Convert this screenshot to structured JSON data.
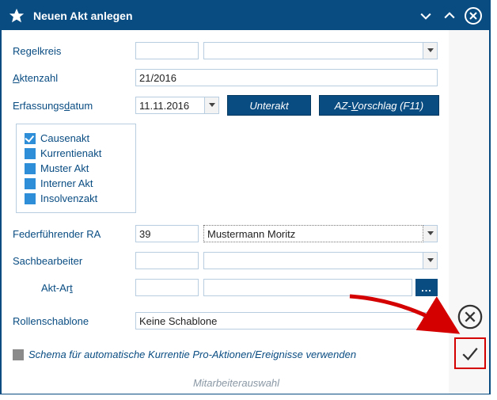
{
  "title": "Neuen Akt anlegen",
  "labels": {
    "regelkreis": "Regelkreis",
    "aktenzahl_pre": "A",
    "aktenzahl_rest": "ktenzahl",
    "erfassungsdatum_pre": "Erfassungs",
    "erfassungsdatum_ul": "d",
    "erfassungsdatum_rest": "atum",
    "federfuehrender": "Federführender RA",
    "sachbearbeiter": "Sachbearbeiter",
    "aktart_pre": "Akt-Ar",
    "aktart_ul": "t",
    "rollenschablone": "Rollenschablone"
  },
  "buttons": {
    "unterakt": "Unterakt",
    "az_pre": "AZ-",
    "az_ul": "V",
    "az_rest": "orschlag (F11)",
    "dots": "..."
  },
  "values": {
    "regelkreis_code": "",
    "regelkreis_text": "",
    "aktenzahl": "21/2016",
    "erfassungsdatum": "11.11.2016",
    "ra_code": "39",
    "ra_name": "Mustermann Moritz",
    "sach_code": "",
    "sach_text": "",
    "aktart_code": "",
    "aktart_text": "",
    "rollenschablone": "Keine Schablone"
  },
  "checks": {
    "causenakt": "Causenakt",
    "kurrentienakt": "Kurrentienakt",
    "musterakt": "Muster Akt",
    "internerakt": "Interner Akt",
    "insolvenzakt": "Insolvenzakt"
  },
  "schema_text": "Schema für automatische Kurrentie Pro-Aktionen/Ereignisse verwenden",
  "footer": "Mitarbeiterauswahl"
}
